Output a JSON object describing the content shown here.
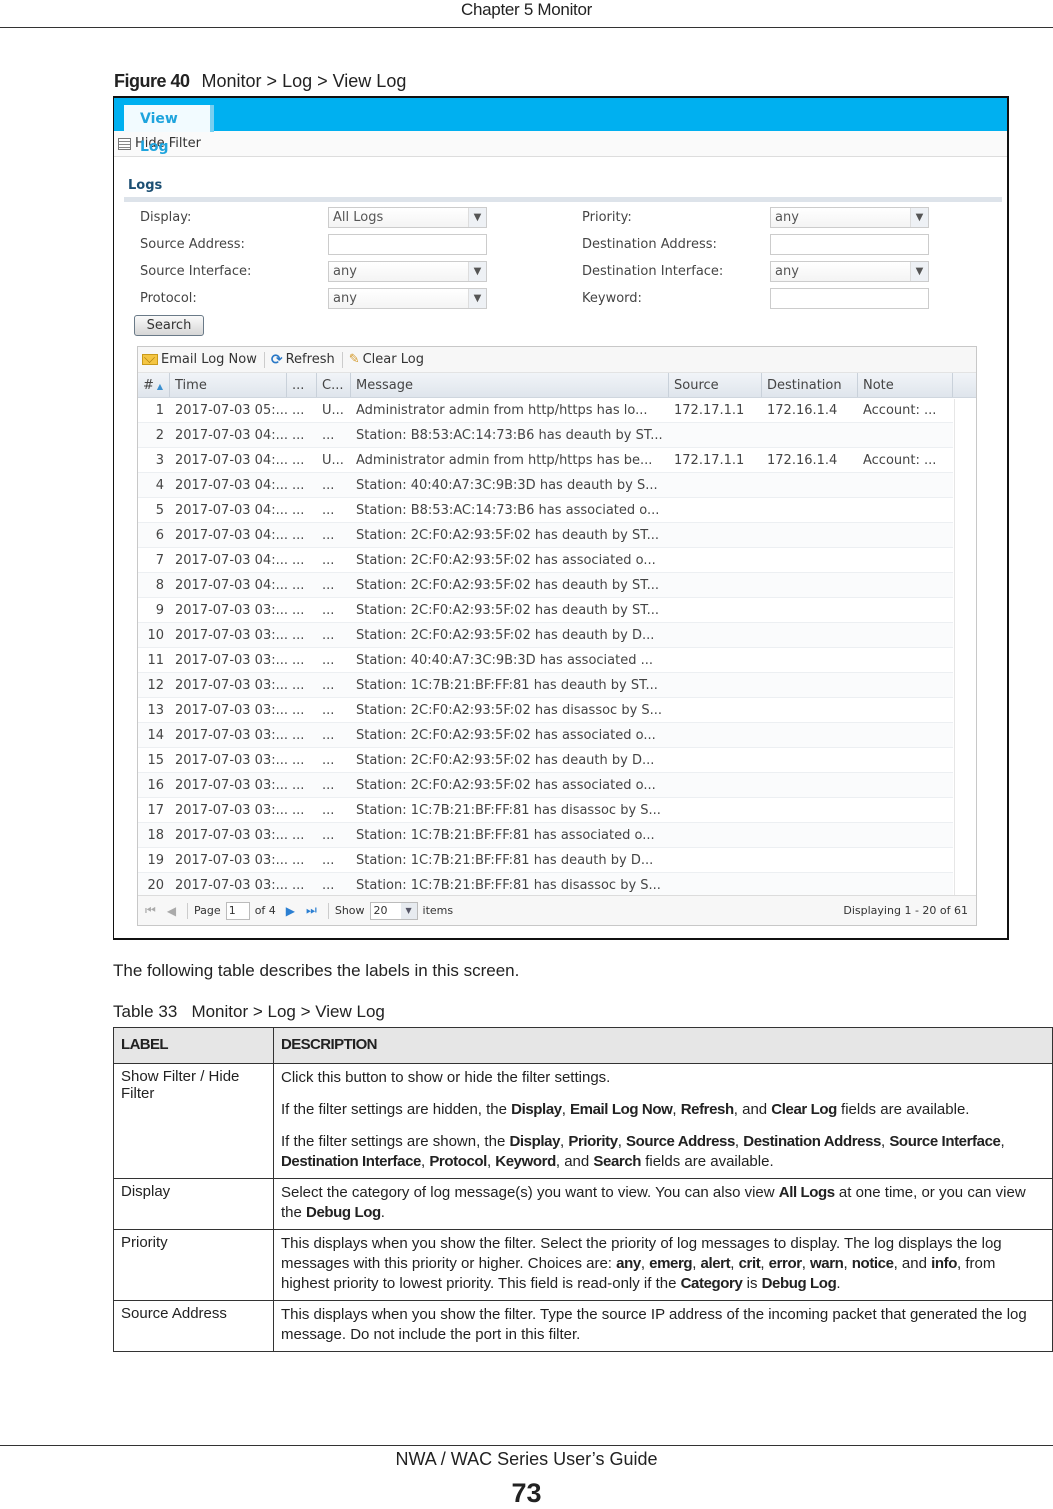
{
  "page": {
    "header": "Chapter 5 Monitor",
    "figure_label": "Figure 40",
    "figure_title": "Monitor > Log > View Log",
    "intro_text": "The following table describes the labels in this screen.",
    "table_caption": "Table 33   Monitor > Log > View Log",
    "footer_guide": "NWA / WAC Series User’s Guide",
    "page_number": "73"
  },
  "app": {
    "tab": "View Log",
    "hide_filter": "Hide Filter",
    "section_title": "Logs",
    "accent_color": "#00b0f0",
    "filters": {
      "display_label": "Display:",
      "display_value": "All Logs",
      "priority_label": "Priority:",
      "priority_value": "any",
      "source_address_label": "Source Address:",
      "source_address_value": "",
      "destination_address_label": "Destination Address:",
      "destination_address_value": "",
      "source_interface_label": "Source Interface:",
      "source_interface_value": "any",
      "destination_interface_label": "Destination Interface:",
      "destination_interface_value": "any",
      "protocol_label": "Protocol:",
      "protocol_value": "any",
      "keyword_label": "Keyword:",
      "keyword_value": "",
      "search_button": "Search"
    },
    "toolbar": {
      "email_log_now": "Email Log Now",
      "refresh": "Refresh",
      "clear_log": "Clear Log"
    },
    "columns": [
      "#",
      "Time",
      "...",
      "C...",
      "Message",
      "Source",
      "Destination",
      "Note"
    ],
    "rows": [
      [
        "1",
        "2017-07-03 05:...",
        "...",
        "U...",
        "Administrator admin from http/https has lo...",
        "172.17.1.1",
        "172.16.1.4",
        "Account: ..."
      ],
      [
        "2",
        "2017-07-03 04:...",
        "...",
        "...",
        "Station: B8:53:AC:14:73:B6 has deauth by ST...",
        "",
        "",
        ""
      ],
      [
        "3",
        "2017-07-03 04:...",
        "...",
        "U...",
        "Administrator admin from http/https has be...",
        "172.17.1.1",
        "172.16.1.4",
        "Account: ..."
      ],
      [
        "4",
        "2017-07-03 04:...",
        "...",
        "...",
        "Station: 40:40:A7:3C:9B:3D has deauth by S...",
        "",
        "",
        ""
      ],
      [
        "5",
        "2017-07-03 04:...",
        "...",
        "...",
        "Station: B8:53:AC:14:73:B6 has associated o...",
        "",
        "",
        ""
      ],
      [
        "6",
        "2017-07-03 04:...",
        "...",
        "...",
        "Station: 2C:F0:A2:93:5F:02 has deauth by ST...",
        "",
        "",
        ""
      ],
      [
        "7",
        "2017-07-03 04:...",
        "...",
        "...",
        "Station: 2C:F0:A2:93:5F:02 has associated o...",
        "",
        "",
        ""
      ],
      [
        "8",
        "2017-07-03 04:...",
        "...",
        "...",
        "Station: 2C:F0:A2:93:5F:02 has deauth by ST...",
        "",
        "",
        ""
      ],
      [
        "9",
        "2017-07-03 03:...",
        "...",
        "...",
        "Station: 2C:F0:A2:93:5F:02 has deauth by ST...",
        "",
        "",
        ""
      ],
      [
        "10",
        "2017-07-03 03:...",
        "...",
        "...",
        "Station: 2C:F0:A2:93:5F:02 has deauth by D...",
        "",
        "",
        ""
      ],
      [
        "11",
        "2017-07-03 03:...",
        "...",
        "...",
        "Station: 40:40:A7:3C:9B:3D has associated ...",
        "",
        "",
        ""
      ],
      [
        "12",
        "2017-07-03 03:...",
        "...",
        "...",
        "Station: 1C:7B:21:BF:FF:81 has deauth by ST...",
        "",
        "",
        ""
      ],
      [
        "13",
        "2017-07-03 03:...",
        "...",
        "...",
        "Station: 2C:F0:A2:93:5F:02 has disassoc by S...",
        "",
        "",
        ""
      ],
      [
        "14",
        "2017-07-03 03:...",
        "...",
        "...",
        "Station: 2C:F0:A2:93:5F:02 has associated o...",
        "",
        "",
        ""
      ],
      [
        "15",
        "2017-07-03 03:...",
        "...",
        "...",
        "Station: 2C:F0:A2:93:5F:02 has deauth by D...",
        "",
        "",
        ""
      ],
      [
        "16",
        "2017-07-03 03:...",
        "...",
        "...",
        "Station: 2C:F0:A2:93:5F:02 has associated o...",
        "",
        "",
        ""
      ],
      [
        "17",
        "2017-07-03 03:...",
        "...",
        "...",
        "Station: 1C:7B:21:BF:FF:81 has disassoc by S...",
        "",
        "",
        ""
      ],
      [
        "18",
        "2017-07-03 03:...",
        "...",
        "...",
        "Station: 1C:7B:21:BF:FF:81 has associated o...",
        "",
        "",
        ""
      ],
      [
        "19",
        "2017-07-03 03:...",
        "...",
        "...",
        "Station: 1C:7B:21:BF:FF:81 has deauth by D...",
        "",
        "",
        ""
      ],
      [
        "20",
        "2017-07-03 03:...",
        "...",
        "...",
        "Station: 1C:7B:21:BF:FF:81 has disassoc by S...",
        "",
        "",
        ""
      ]
    ],
    "pager": {
      "page_label": "Page",
      "page_value": "1",
      "of_label": "of 4",
      "show_label": "Show",
      "show_value": "20",
      "items_label": "items",
      "status": "Displaying 1 - 20 of 61"
    }
  },
  "doc_table": {
    "headers": [
      "LABEL",
      "DESCRIPTION"
    ],
    "rows": [
      {
        "label": "Show Filter / Hide Filter",
        "paragraphs": [
          [
            {
              "t": "Click this button to show or hide the filter settings."
            }
          ],
          [
            {
              "t": "If the filter settings are hidden, the "
            },
            {
              "b": "Display"
            },
            {
              "t": ", "
            },
            {
              "b": "Email Log Now"
            },
            {
              "t": ", "
            },
            {
              "b": "Refresh"
            },
            {
              "t": ", and "
            },
            {
              "b": "Clear Log"
            },
            {
              "t": " fields are available."
            }
          ],
          [
            {
              "t": "If the filter settings are shown, the "
            },
            {
              "b": "Display"
            },
            {
              "t": ", "
            },
            {
              "b": "Priority"
            },
            {
              "t": ", "
            },
            {
              "b": "Source Address"
            },
            {
              "t": ", "
            },
            {
              "b": "Destination Address"
            },
            {
              "t": ", "
            },
            {
              "b": "Source Interface"
            },
            {
              "t": ", "
            },
            {
              "b": "Destination Interface"
            },
            {
              "t": ", "
            },
            {
              "b": "Protocol"
            },
            {
              "t": ", "
            },
            {
              "b": "Keyword"
            },
            {
              "t": ", and "
            },
            {
              "b": "Search"
            },
            {
              "t": " fields are available."
            }
          ]
        ]
      },
      {
        "label": "Display",
        "paragraphs": [
          [
            {
              "t": "Select the category of log message(s) you want to view. You can also view "
            },
            {
              "b": "All Logs"
            },
            {
              "t": " at one time, or you can view the "
            },
            {
              "b": "Debug Log"
            },
            {
              "t": "."
            }
          ]
        ]
      },
      {
        "label": "Priority",
        "paragraphs": [
          [
            {
              "t": "This displays when you show the filter. Select the priority of log messages to display. The log displays the log messages with this priority or higher. Choices are: "
            },
            {
              "b": "any"
            },
            {
              "t": ", "
            },
            {
              "b": "emerg"
            },
            {
              "t": ", "
            },
            {
              "b": "alert"
            },
            {
              "t": ", "
            },
            {
              "b": "crit"
            },
            {
              "t": ", "
            },
            {
              "b": "error"
            },
            {
              "t": ", "
            },
            {
              "b": "warn"
            },
            {
              "t": ", "
            },
            {
              "b": "notice"
            },
            {
              "t": ", and "
            },
            {
              "b": "info"
            },
            {
              "t": ", from highest priority to lowest priority. This field is read-only if the "
            },
            {
              "b": "Category"
            },
            {
              "t": " is "
            },
            {
              "b": "Debug Log"
            },
            {
              "t": "."
            }
          ]
        ]
      },
      {
        "label": "Source Address",
        "paragraphs": [
          [
            {
              "t": "This displays when you show the filter. Type the source IP address of the incoming packet that generated the log message. Do not include the port in this filter."
            }
          ]
        ]
      }
    ]
  }
}
